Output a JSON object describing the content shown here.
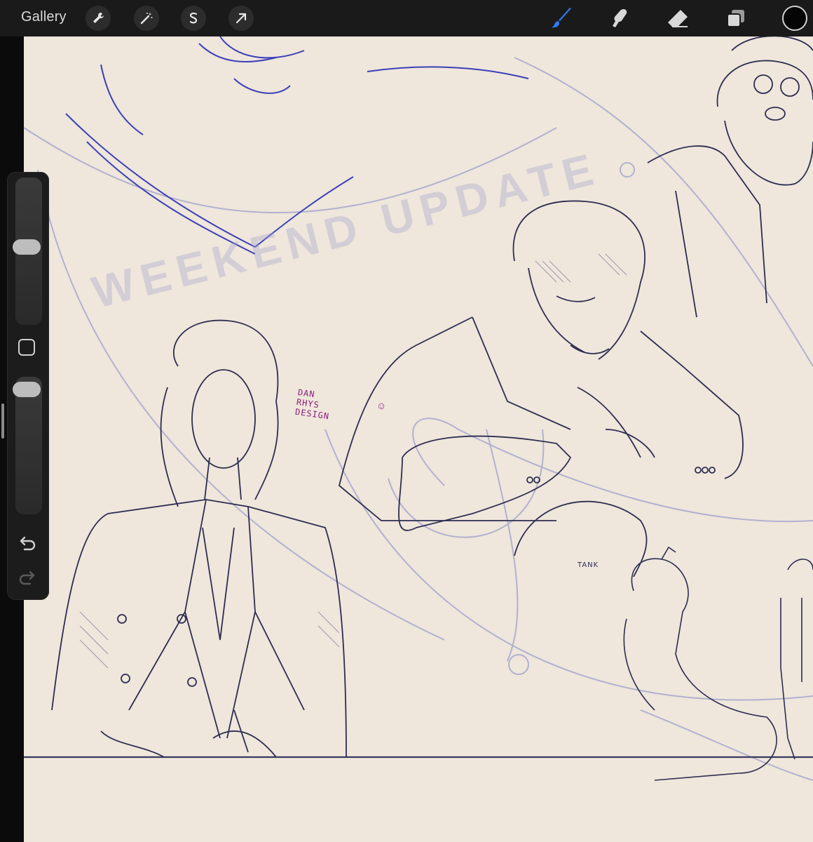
{
  "topbar": {
    "gallery_label": "Gallery",
    "left_tools": [
      {
        "name": "wrench-icon",
        "label": "Actions"
      },
      {
        "name": "magic-wand-icon",
        "label": "Adjustments"
      },
      {
        "name": "selection-icon",
        "label": "Selection"
      },
      {
        "name": "transform-arrow-icon",
        "label": "Transform"
      }
    ],
    "right_tools": [
      {
        "name": "brush-icon",
        "active": true
      },
      {
        "name": "smudge-icon",
        "active": false
      },
      {
        "name": "eraser-icon",
        "active": false
      },
      {
        "name": "layers-icon",
        "active": false
      }
    ],
    "current_color": "#050505",
    "active_color": "#2f7bf5"
  },
  "sidebar": {
    "brush_size_fraction": 0.53,
    "opacity_fraction": 0.97
  },
  "canvas": {
    "background": "#efe6dc",
    "watermark": "WEEKEND UPDATE",
    "signature": "DAN\nRHYS\nDESIGN",
    "signature_smile": "☺",
    "shirt_text": "",
    "shirt_text_small": "TANK"
  }
}
